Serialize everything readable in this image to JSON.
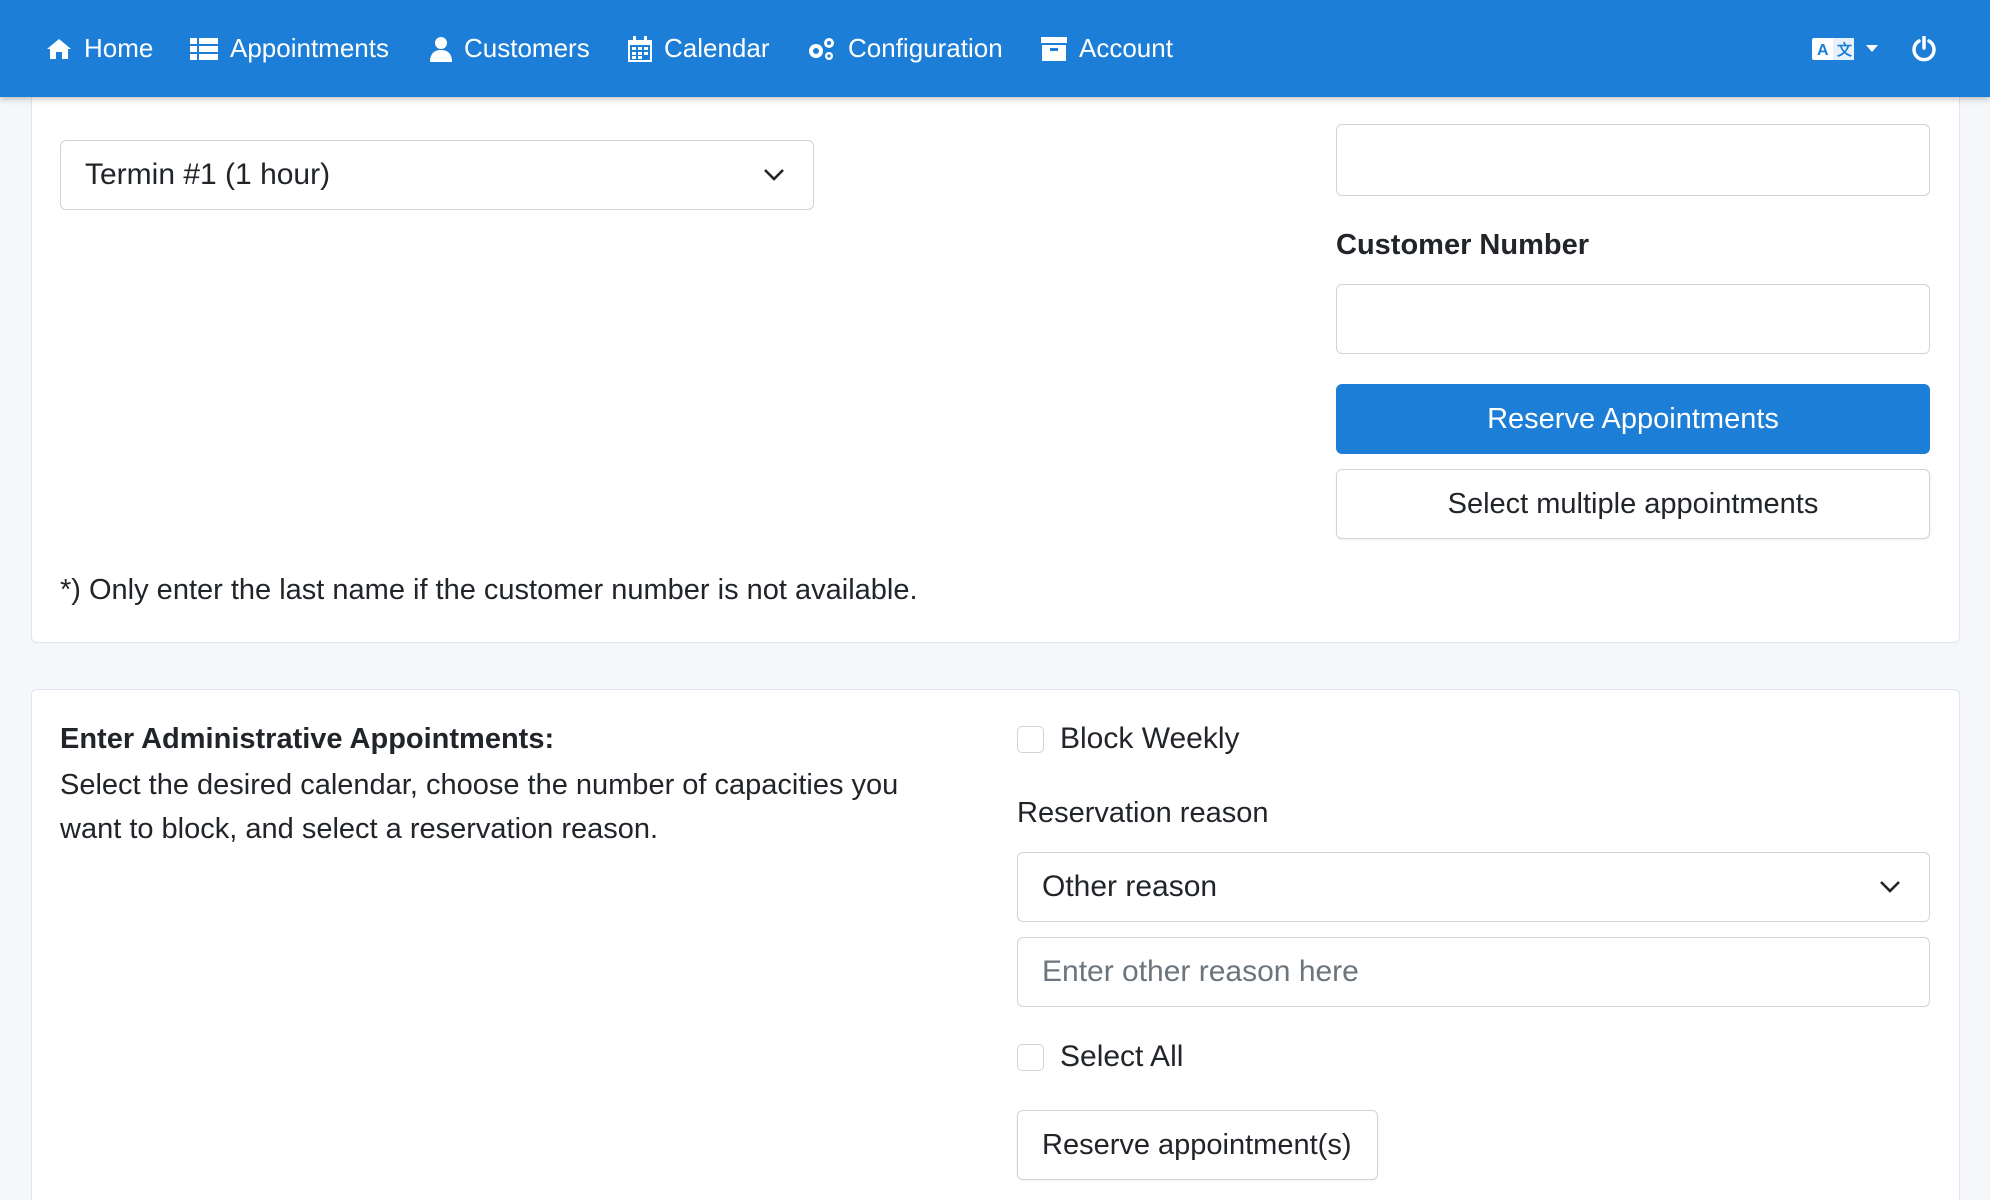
{
  "nav": {
    "items": [
      {
        "label": "Home",
        "icon": "home-icon"
      },
      {
        "label": "Appointments",
        "icon": "list-icon"
      },
      {
        "label": "Customers",
        "icon": "user-icon"
      },
      {
        "label": "Calendar",
        "icon": "calendar-icon"
      },
      {
        "label": "Configuration",
        "icon": "gears-icon"
      },
      {
        "label": "Account",
        "icon": "archive-icon"
      }
    ],
    "language_icon": "language-icon",
    "power_icon": "power-icon"
  },
  "booking": {
    "appointment_type_selected": "Termin #1 (1 hour)",
    "customer_number_label": "Customer Number",
    "reserve_button": "Reserve Appointments",
    "multi_button": "Select multiple appointments",
    "note": "*) Only enter the last name if the customer number is not available."
  },
  "admin": {
    "title": "Enter Administrative Appointments:",
    "description": "Select the desired calendar, choose the number of capacities you want to block, and select a reservation reason.",
    "block_weekly_label": "Block Weekly",
    "reason_label": "Reservation reason",
    "reason_selected": "Other reason",
    "other_reason_placeholder": "Enter other reason here",
    "select_all_label": "Select All",
    "reserve_button": "Reserve appointment(s)"
  },
  "colors": {
    "primary": "#1c7ed6",
    "background": "#f5f7fa"
  }
}
